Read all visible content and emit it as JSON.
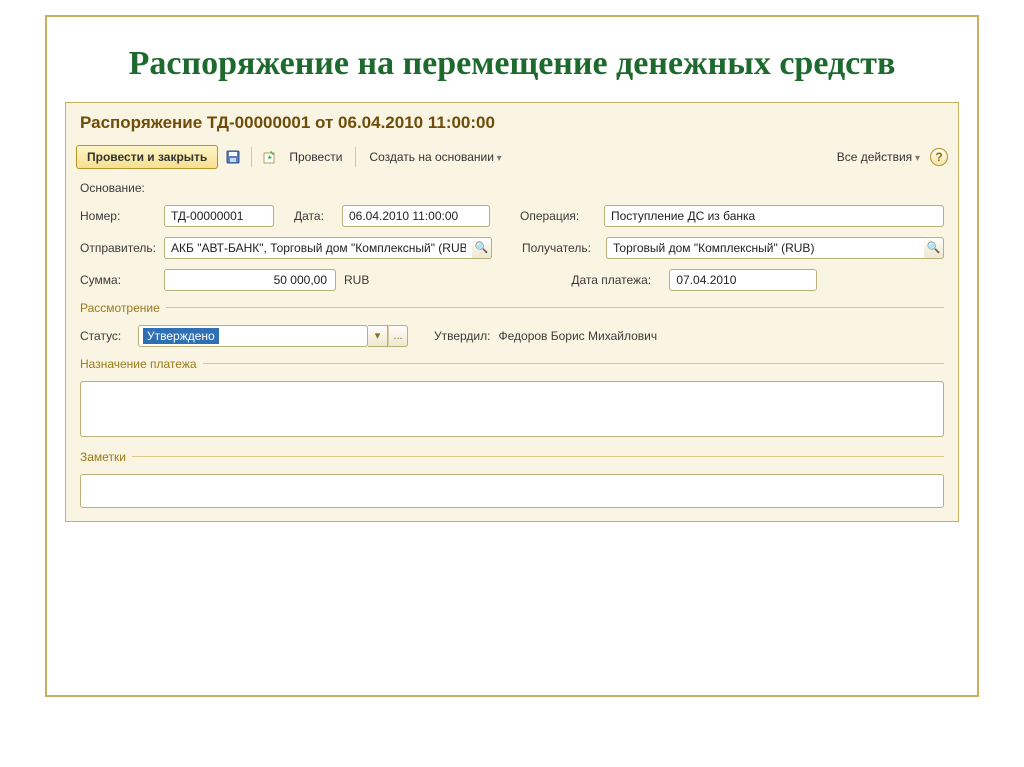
{
  "slide": {
    "title": "Распоряжение на перемещение денежных средств"
  },
  "doc": {
    "title": "Распоряжение ТД-00000001 от 06.04.2010 11:00:00"
  },
  "toolbar": {
    "main_button": "Провести и закрыть",
    "post": "Провести",
    "create_based": "Создать на основании",
    "all_actions": "Все действия",
    "help": "?"
  },
  "labels": {
    "osnovanie": "Основание:",
    "nomer": "Номер:",
    "data": "Дата:",
    "operatsiya": "Операция:",
    "otpravitel": "Отправитель:",
    "poluchatel": "Получатель:",
    "summa": "Сумма:",
    "currency": "RUB",
    "data_platezha": "Дата платежа:",
    "rassmotrenie": "Рассмотрение",
    "status": "Статус:",
    "utverdil_label": "Утвердил:",
    "naznachenie": "Назначение платежа",
    "zametki": "Заметки"
  },
  "values": {
    "nomer": "ТД-00000001",
    "data": "06.04.2010 11:00:00",
    "operatsiya": "Поступление ДС из банка",
    "otpravitel": "АКБ \"АВТ-БАНК\", Торговый дом \"Комплексный\" (RUB",
    "poluchatel": "Торговый дом \"Комплексный\" (RUB)",
    "summa": "50 000,00",
    "data_platezha": "07.04.2010",
    "status": "Утверждено",
    "utverdil": "Федоров Борис Михайлович"
  },
  "icons": {
    "ellipsis": "...",
    "search": "🔍",
    "dropdown": "▾"
  }
}
